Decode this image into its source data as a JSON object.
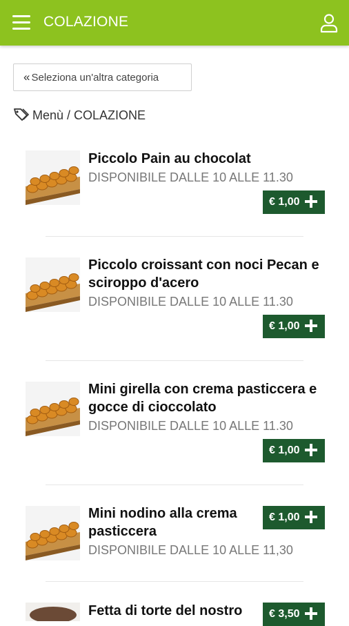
{
  "header": {
    "title": "COLAZIONE"
  },
  "back_button": {
    "label": "Seleziona un'altra categoria"
  },
  "breadcrumb": {
    "text": "Menù / COLAZIONE"
  },
  "items": [
    {
      "name": "Piccolo Pain au chocolat",
      "availability": "DISPONIBILE DALLE 10 ALLE 11.30",
      "price": "€ 1,00"
    },
    {
      "name": "Piccolo croissant con noci Pecan e sciroppo d'acero",
      "availability": "DISPONIBILE DALLE 10 ALLE 11.30",
      "price": "€ 1,00"
    },
    {
      "name": "Mini girella con crema pasticcera e gocce di cioccolato",
      "availability": "DISPONIBILE DALLE 10 ALLE 11.30",
      "price": "€ 1,00"
    },
    {
      "name": "Mini nodino alla crema pasticcera",
      "availability": "DISPONIBILE DALLE 10 ALLE 11,30",
      "price": "€ 1,00"
    },
    {
      "name": "Fetta di torte del nostro",
      "availability": "",
      "price": "€ 3,50"
    }
  ],
  "colors": {
    "header_bg": "#8dc21f",
    "price_bg": "#1d5a2e",
    "availability_text": "#777777"
  },
  "icons": {
    "menu": "menu-icon",
    "user": "user-icon",
    "back": "double-chevron-left-icon",
    "breadcrumb": "tag-icon",
    "add": "plus-icon"
  }
}
